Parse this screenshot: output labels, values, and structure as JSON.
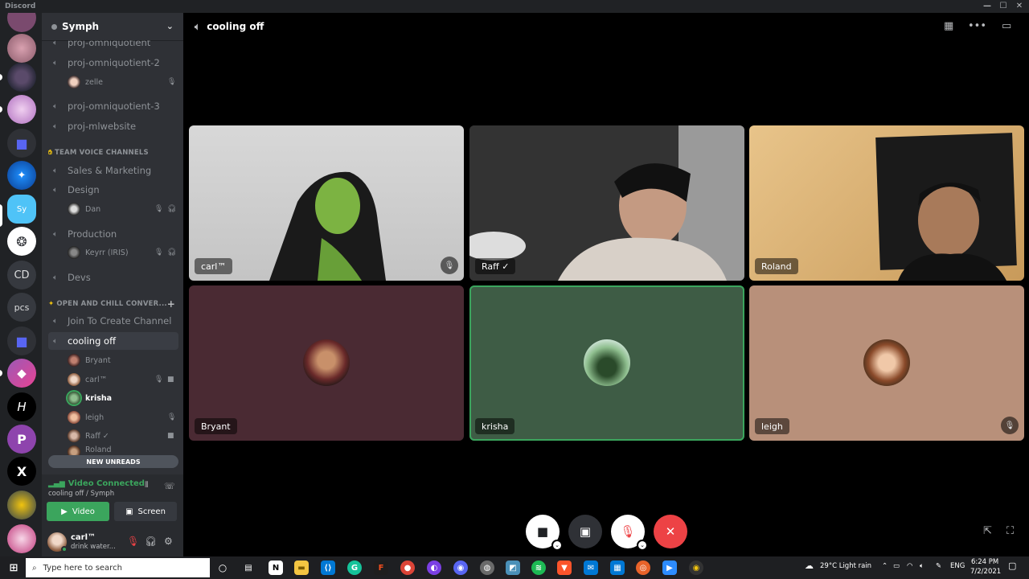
{
  "window": {
    "title": "Discord"
  },
  "rail": {
    "text_servers": [
      "CD",
      "pcs"
    ]
  },
  "guild": {
    "name": "Symph"
  },
  "channels": {
    "c1": "proj-omniquotient",
    "c2": "proj-omniquotient-2",
    "c3": "proj-omniquotient-3",
    "c4": "proj-mlwebsite",
    "cat_team": "TEAM VOICE CHANNELS",
    "c5": "Sales & Marketing",
    "c6": "Design",
    "c7": "Production",
    "c8": "Devs",
    "cat_open": "OPEN AND CHILL CONVER...",
    "c9": "Join To Create Channel",
    "c10": "cooling off"
  },
  "voice_users": {
    "zelle": "zelle",
    "dan": "Dan",
    "keyrr": "Keyrr (IRIS)",
    "bryant": "Bryant",
    "carl": "carl™",
    "krisha": "krisha",
    "leigh": "leigh",
    "raff": "Raff ✓",
    "roland": "Roland"
  },
  "new_unreads": "NEW UNREADS",
  "rtc": {
    "status": "Video Connected",
    "sub": "cooling off / Symph",
    "video_label": "Video",
    "screen_label": "Screen"
  },
  "user": {
    "name": "carl™",
    "custom_status": "drink water..."
  },
  "stage": {
    "channel_title": "cooling off"
  },
  "tiles": [
    {
      "label": "carl™"
    },
    {
      "label": "Raff ✓"
    },
    {
      "label": "Roland"
    },
    {
      "label": "Bryant"
    },
    {
      "label": "krisha"
    },
    {
      "label": "leigh"
    }
  ],
  "taskbar": {
    "search_placeholder": "Type here to search",
    "weather": "29°C  Light rain",
    "lang": "ENG",
    "time": "6:24 PM",
    "date": "7/2/2021"
  },
  "colors": {
    "speaking_green": "#3ba55d",
    "hangup_red": "#ed4245",
    "video_green": "#3ba55d"
  }
}
